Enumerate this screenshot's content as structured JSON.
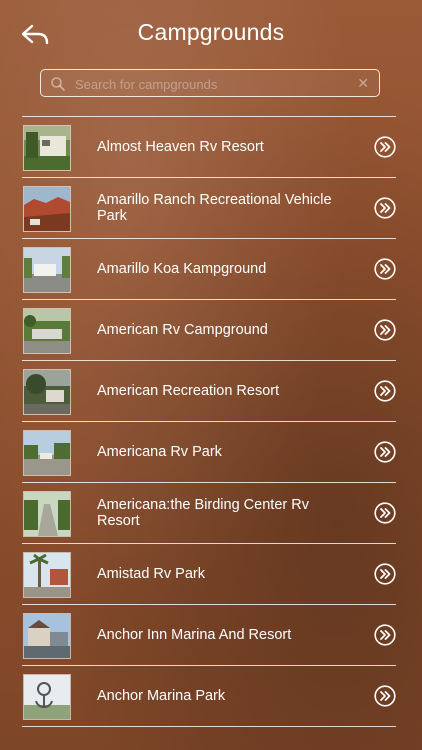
{
  "header": {
    "title": "Campgrounds"
  },
  "search": {
    "placeholder": "Search for campgrounds"
  },
  "items": [
    {
      "label": "Almost Heaven Rv Resort"
    },
    {
      "label": "Amarillo Ranch Recreational Vehicle Park"
    },
    {
      "label": "Amarillo Koa Kampground"
    },
    {
      "label": "American Rv Campground"
    },
    {
      "label": "American Recreation Resort"
    },
    {
      "label": "Americana Rv Park"
    },
    {
      "label": "Americana:the Birding Center Rv Resort"
    },
    {
      "label": "Amistad Rv Park"
    },
    {
      "label": "Anchor Inn Marina And Resort"
    },
    {
      "label": "Anchor Marina Park"
    }
  ],
  "icons": {
    "back": "back-arrow-icon",
    "search": "search-icon",
    "clear": "clear-icon",
    "row_arrow": "chevron-double-right-icon"
  },
  "colors": {
    "background": "#93522f",
    "text": "#ffffff"
  }
}
